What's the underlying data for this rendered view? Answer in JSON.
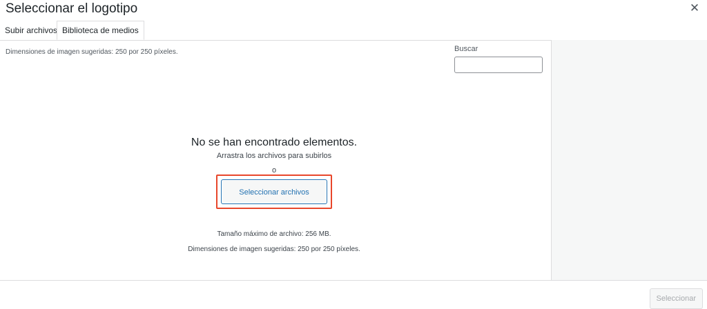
{
  "header": {
    "title": "Seleccionar el logotipo",
    "close_glyph": "✕",
    "close_icon": "close-icon"
  },
  "tabs": [
    {
      "label": "Subir archivos",
      "active": false
    },
    {
      "label": "Biblioteca de medios",
      "active": true
    }
  ],
  "library": {
    "suggested_dimensions": "Dimensiones de imagen sugeridas: 250 por 250 píxeles.",
    "search": {
      "label": "Buscar",
      "value": "",
      "placeholder": ""
    }
  },
  "uploader": {
    "empty_title": "No se han encontrado elementos.",
    "drag_text": "Arrastra los archivos para subirlos",
    "or_text": "o",
    "select_files_label": "Seleccionar archivos",
    "max_size": "Tamaño máximo de archivo: 256 MB.",
    "suggested_dimensions": "Dimensiones de imagen sugeridas: 250 por 250 píxeles."
  },
  "toolbar": {
    "select_label": "Seleccionar",
    "select_disabled": true
  },
  "colors": {
    "accent": "#2271b1",
    "highlight": "#e8462a",
    "sidebar_bg": "#f6f7f7"
  }
}
